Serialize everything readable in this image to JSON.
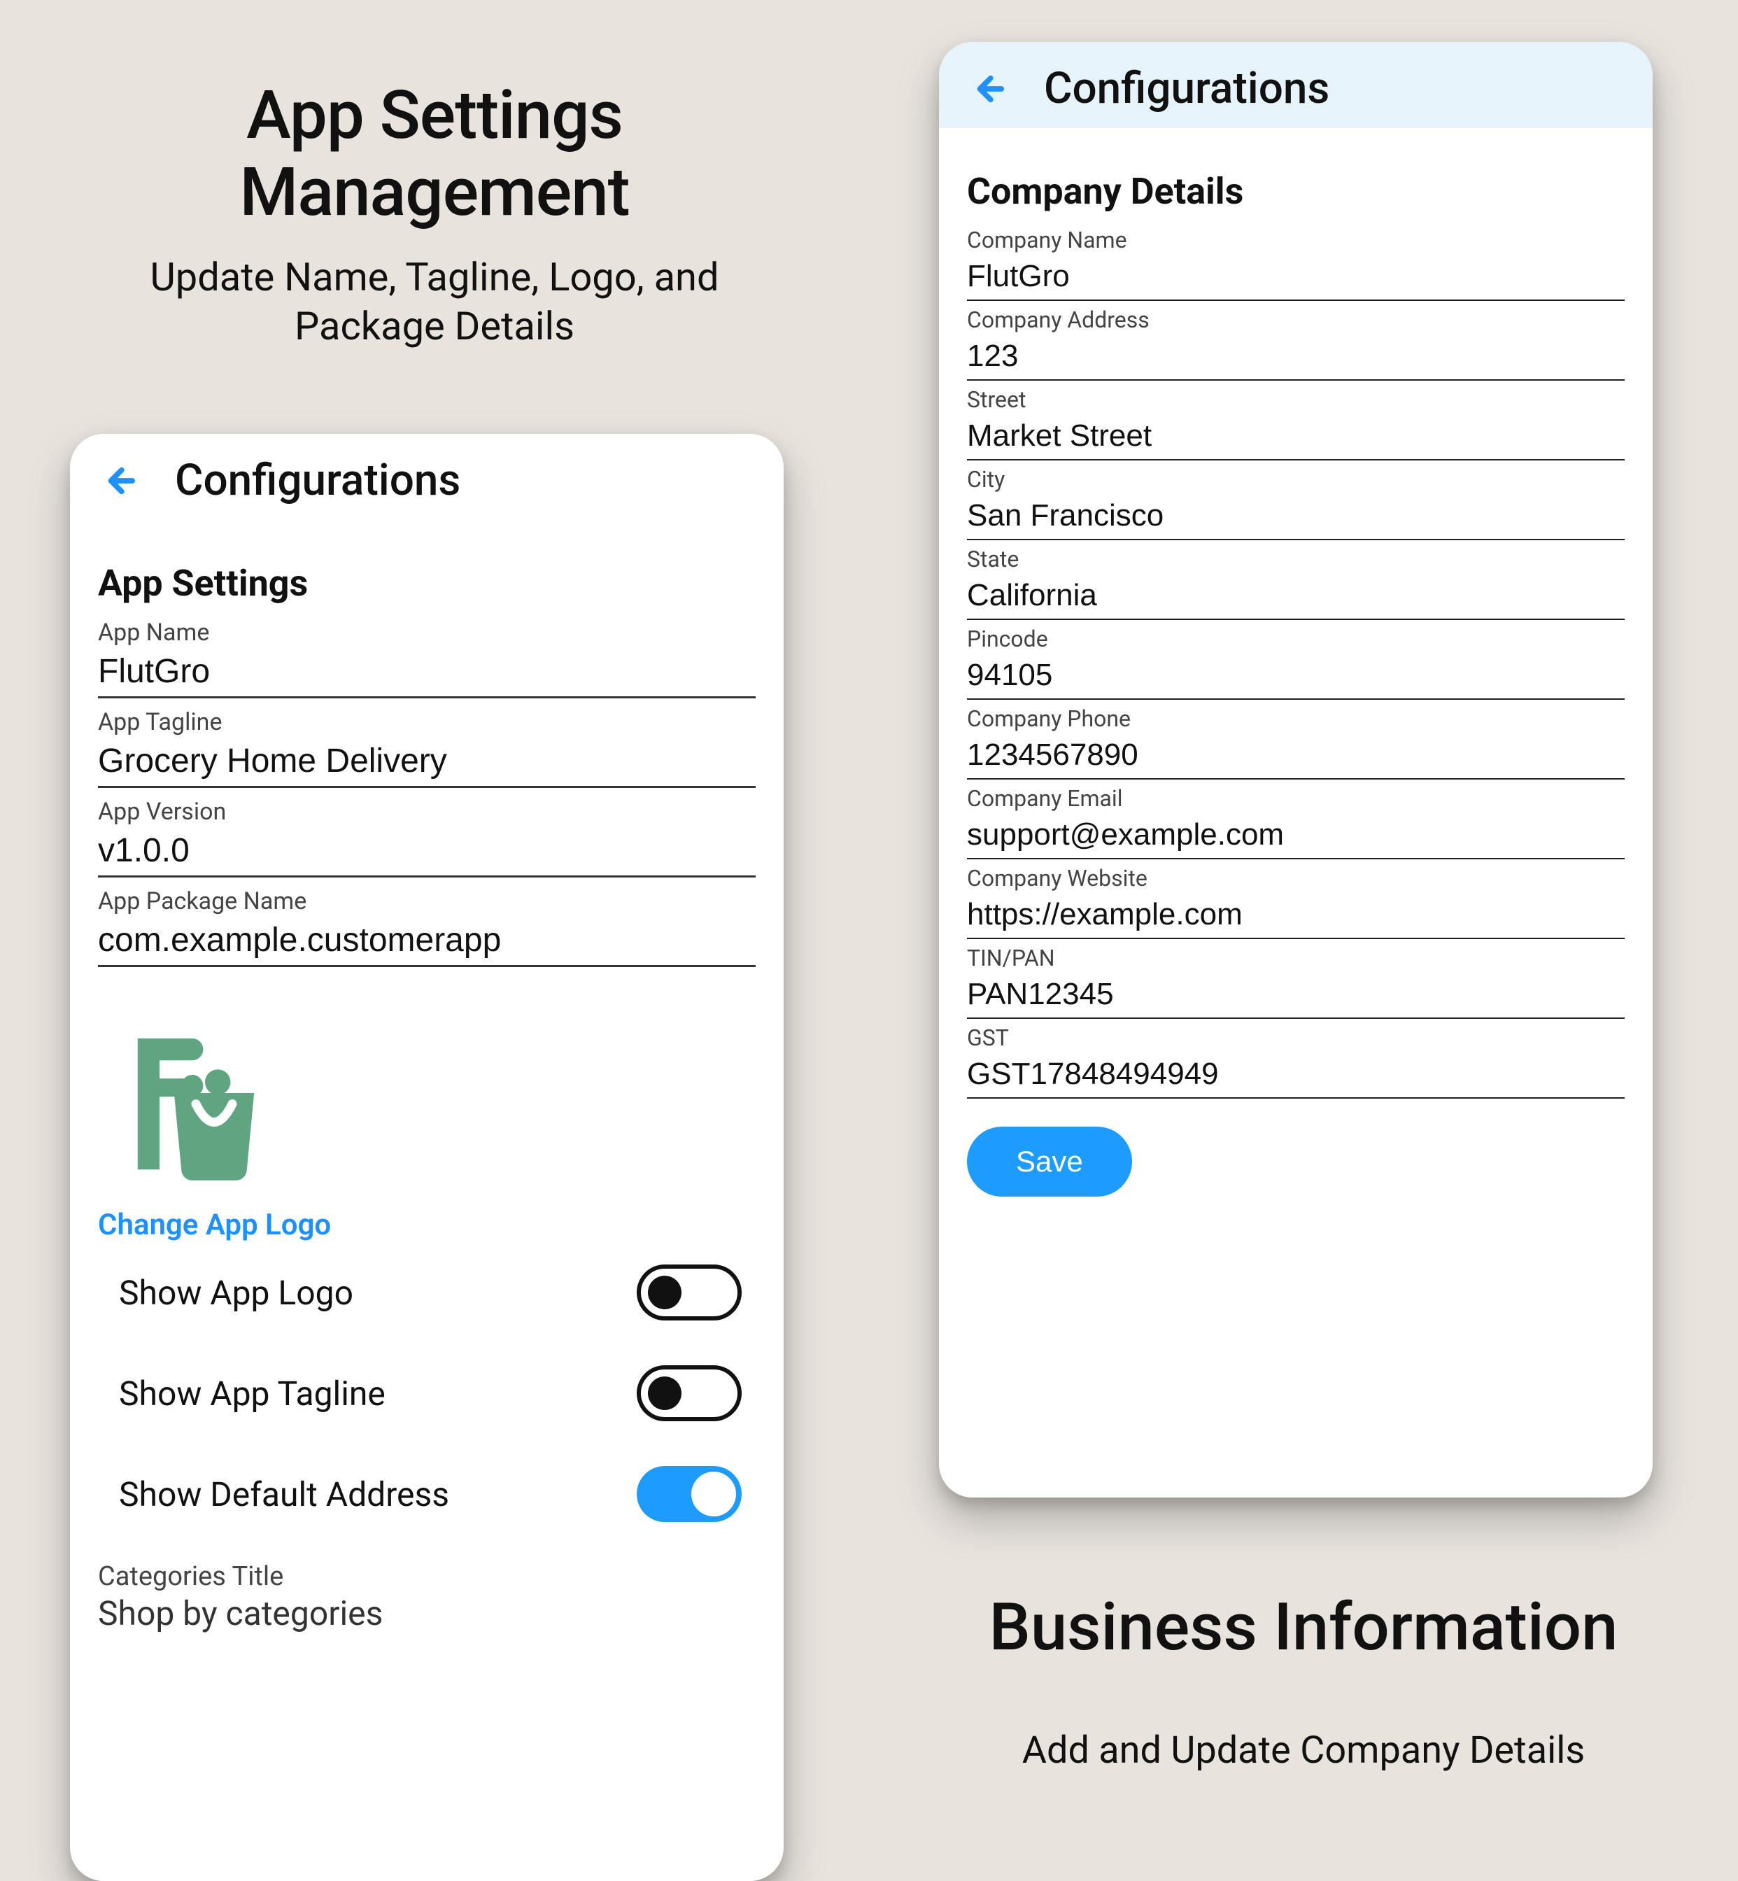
{
  "left": {
    "hero_title_line1": "App Settings",
    "hero_title_line2": "Management",
    "hero_sub_line1": "Update Name, Tagline, Logo, and",
    "hero_sub_line2": "Package Details",
    "appbar_title": "Configurations",
    "section_title": "App Settings",
    "fields": {
      "app_name": {
        "label": "App Name",
        "value": "FlutGro"
      },
      "app_tagline": {
        "label": "App Tagline",
        "value": "Grocery Home Delivery"
      },
      "app_version": {
        "label": "App Version",
        "value": "v1.0.0"
      },
      "app_package": {
        "label": "App Package Name",
        "value": "com.example.customerapp"
      }
    },
    "change_logo": "Change App Logo",
    "toggles": {
      "show_logo": "Show App Logo",
      "show_tagline": "Show App Tagline",
      "show_default_address": "Show Default Address"
    },
    "categories_label": "Categories Title",
    "categories_value": "Shop by categories"
  },
  "right": {
    "appbar_title": "Configurations",
    "section_title": "Company Details",
    "fields": {
      "company_name": {
        "label": "Company Name",
        "value": "FlutGro"
      },
      "company_address": {
        "label": "Company Address",
        "value": "123"
      },
      "street": {
        "label": "Street",
        "value": "Market Street"
      },
      "city": {
        "label": "City",
        "value": "San Francisco"
      },
      "state": {
        "label": "State",
        "value": "California"
      },
      "pincode": {
        "label": "Pincode",
        "value": "94105"
      },
      "company_phone": {
        "label": "Company Phone",
        "value": "1234567890"
      },
      "company_email": {
        "label": "Company Email",
        "value": "support@example.com"
      },
      "company_website": {
        "label": "Company Website",
        "value": "https://example.com"
      },
      "tin_pan": {
        "label": "TIN/PAN",
        "value": "PAN12345"
      },
      "gst": {
        "label": "GST",
        "value": "GST17848494949"
      }
    },
    "save_label": "Save",
    "hero_title": "Business Information",
    "hero_sub": "Add and Update Company Details"
  }
}
